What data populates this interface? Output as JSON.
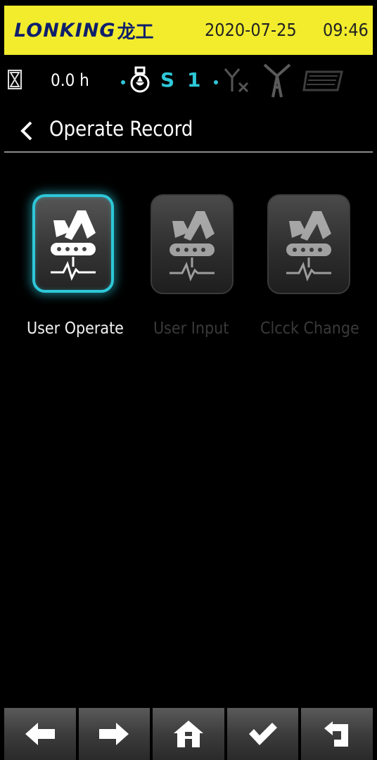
{
  "header": {
    "brand": "LONKING",
    "brand_cn": "龙工",
    "date": "2020-07-25",
    "time": "09:46"
  },
  "status": {
    "hours": "0.0 h",
    "gear_letter": "S",
    "gear_number": "1",
    "accent_color": "#2ec7d8"
  },
  "breadcrumb": {
    "back_icon": "chevron-left-icon",
    "title": "Operate Record"
  },
  "tiles": [
    {
      "label": "User Operate",
      "selected": true
    },
    {
      "label": "User Input",
      "selected": false
    },
    {
      "label": "Clcck Change",
      "selected": false
    }
  ],
  "bottom_bar": [
    {
      "icon": "arrow-left-icon"
    },
    {
      "icon": "arrow-right-icon"
    },
    {
      "icon": "home-icon"
    },
    {
      "icon": "check-icon"
    },
    {
      "icon": "return-icon"
    }
  ]
}
